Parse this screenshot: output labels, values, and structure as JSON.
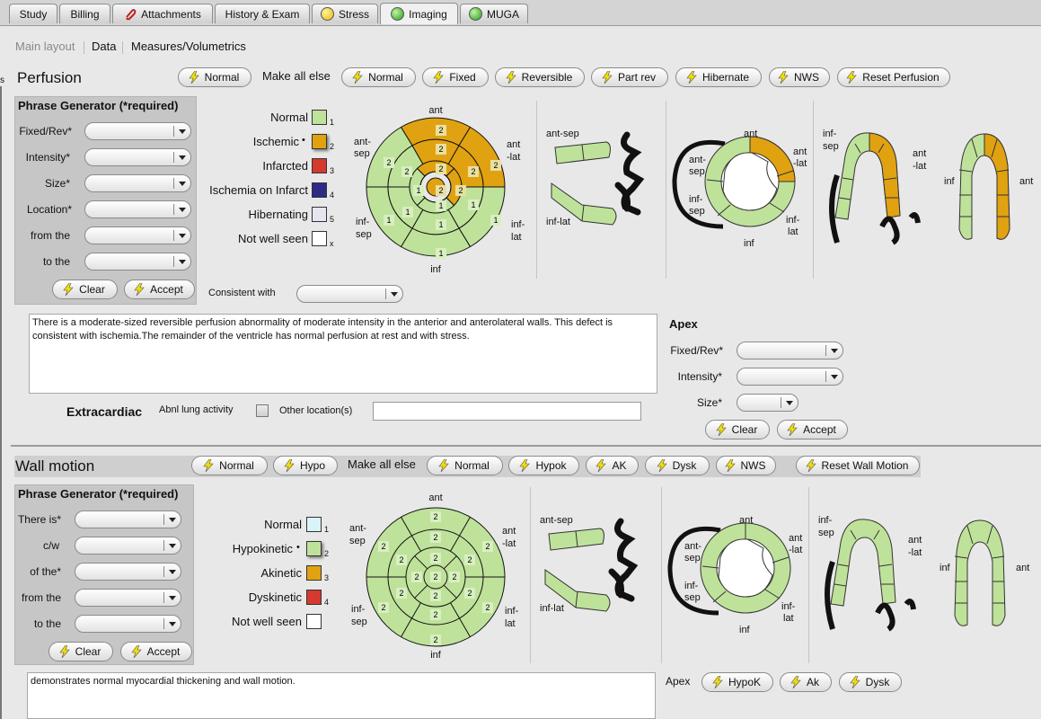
{
  "tabs": [
    "Study",
    "Billing",
    "Attachments",
    "History & Exam",
    "Stress",
    "Imaging",
    "MUGA"
  ],
  "subnav": {
    "main_layout": "Main layout",
    "data": "Data",
    "measures": "Measures/Volumetrics"
  },
  "perfusion": {
    "title": "Perfusion",
    "normal_btn": "Normal",
    "make_all_else": "Make all else",
    "buttons": [
      "Normal",
      "Fixed",
      "Reversible",
      "Part rev",
      "Hibernate",
      "NWS",
      "Reset Perfusion"
    ],
    "phrase_title": "Phrase Generator (*required)",
    "fields": [
      "Fixed/Rev*",
      "Intensity*",
      "Size*",
      "Location*",
      "from the",
      "to the"
    ],
    "clear": "Clear",
    "accept": "Accept",
    "legend": [
      {
        "label": "Normal",
        "num": "1",
        "color": "#bfe29b"
      },
      {
        "label": "Ischemic",
        "num": "2",
        "color": "#e1a211"
      },
      {
        "label": "Infarcted",
        "num": "3",
        "color": "#d43a2f"
      },
      {
        "label": "Ischemia on Infarct",
        "num": "4",
        "color": "#2e2a86"
      },
      {
        "label": "Hibernating",
        "num": "5",
        "color": "#e6e6f0"
      },
      {
        "label": "Not well seen",
        "num": "x",
        "color": "#ffffff"
      }
    ],
    "consistent_with": "Consistent with",
    "report": "There is a moderate-sized reversible perfusion abnormality of moderate intensity in the anterior and anterolateral walls.  This defect is consistent with ischemia.The remainder of the ventricle has normal perfusion at rest and with stress.",
    "apex_title": "Apex",
    "apex_fields": [
      "Fixed/Rev*",
      "Intensity*",
      "Size*"
    ],
    "extracardiac": "Extracardiac",
    "abnl_lung": "Abnl lung activity",
    "other_location": "Other location(s)"
  },
  "wall_motion": {
    "title": "Wall motion",
    "normal_btn": "Normal",
    "hypo_btn": "Hypo",
    "make_all_else": "Make all else",
    "buttons": [
      "Normal",
      "Hypok",
      "AK",
      "Dysk",
      "NWS",
      "Reset Wall Motion"
    ],
    "phrase_title": "Phrase Generator (*required)",
    "fields": [
      "There is*",
      "c/w",
      "of the*",
      "from the",
      "to the"
    ],
    "clear": "Clear",
    "accept": "Accept",
    "legend": [
      {
        "label": "Normal",
        "num": "1",
        "color": "#d8f4f8"
      },
      {
        "label": "Hypokinetic",
        "num": "2",
        "color": "#bfe29b"
      },
      {
        "label": "Akinetic",
        "num": "3",
        "color": "#e1a211"
      },
      {
        "label": "Dyskinetic",
        "num": "4",
        "color": "#d43a2f"
      },
      {
        "label": "Not well seen",
        "num": "",
        "color": "#ffffff"
      }
    ],
    "report": "demonstrates normal myocardial thickening and wall motion.",
    "apex_title": "Apex",
    "apex_buttons": [
      "HypoK",
      "Ak",
      "Dysk"
    ]
  },
  "bullseye_labels": {
    "ant": "ant",
    "inf": "inf",
    "ant_sep": "ant-\nsep",
    "inf_sep": "inf-\nsep",
    "ant_lat": "ant\n-lat",
    "inf_lat": "inf-\nlat",
    "inf_lat2": "inf-lat",
    "ant_sep2": "ant-sep"
  },
  "perfusion_scores": {
    "outer": [
      "2",
      "2",
      "1",
      "1",
      "1",
      "2"
    ],
    "mid": [
      "2",
      "2",
      "1",
      "1",
      "1",
      "2"
    ],
    "inner": [
      "2",
      "2",
      "1",
      "1"
    ],
    "apex": "2"
  },
  "wall_scores": {
    "outer": [
      "2",
      "2",
      "2",
      "2",
      "2",
      "2"
    ],
    "mid": [
      "2",
      "2",
      "2",
      "2",
      "2",
      "2"
    ],
    "inner": [
      "2",
      "2",
      "2",
      "2"
    ],
    "apex": "2"
  },
  "colors": {
    "normal": "#bfe29b",
    "ischemic": "#e1a211",
    "panel": "#c6c6c6"
  }
}
